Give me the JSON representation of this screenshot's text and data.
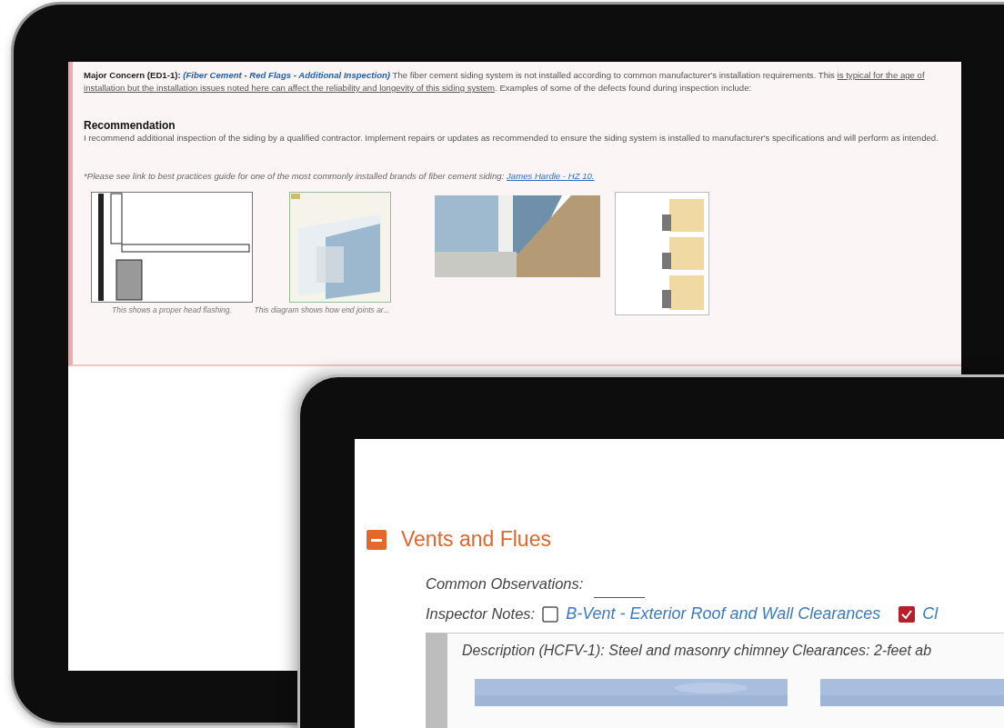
{
  "back_tablet": {
    "concern": {
      "label": "Major Concern (ED1-1):",
      "tag": "(Fiber Cement - Red Flags - Additional Inspection)",
      "text_before": " The fiber cement siding system is not installed according to common manufacturer's installation requirements. This ",
      "underlined": "is typical for the age of installation but the installation issues noted here can affect the reliability and longevity of this siding system",
      "text_after": ". Examples of some of the defects found during inspection include:"
    },
    "recommendation": {
      "heading": "Recommendation",
      "text": "I recommend additional inspection of the siding by a qualified contractor. Implement repairs or updates as recommended to ensure the siding system is installed to manufacturer's specifications and will perform as intended."
    },
    "note": {
      "text": "*Please see link to best practices guide for one of the most commonly installed brands of fiber cement siding: ",
      "link": "James Hardie - HZ 10."
    },
    "images": [
      {
        "kind": "picture",
        "caption": "This shows a proper head flashing."
      },
      {
        "kind": "picture",
        "caption": "This diagram shows how end joints ar..."
      },
      {
        "kind": "picture"
      },
      {
        "kind": "picture"
      }
    ]
  },
  "front_tablet": {
    "section": {
      "title": "Vents and Flues",
      "expanded": true
    },
    "common_observations": {
      "label": "Common Observations:"
    },
    "inspector_notes": {
      "label": "Inspector Notes:",
      "options": [
        {
          "label": "B-Vent - Exterior Roof and Wall Clearances",
          "checked": false
        },
        {
          "label": "Cl",
          "checked": true
        }
      ]
    },
    "description": {
      "text": "Description (HCFV-1): Steel and masonry chimney Clearances: 2-feet ab",
      "images": [
        {
          "kind": "picture"
        },
        {
          "kind": "picture"
        }
      ]
    }
  }
}
